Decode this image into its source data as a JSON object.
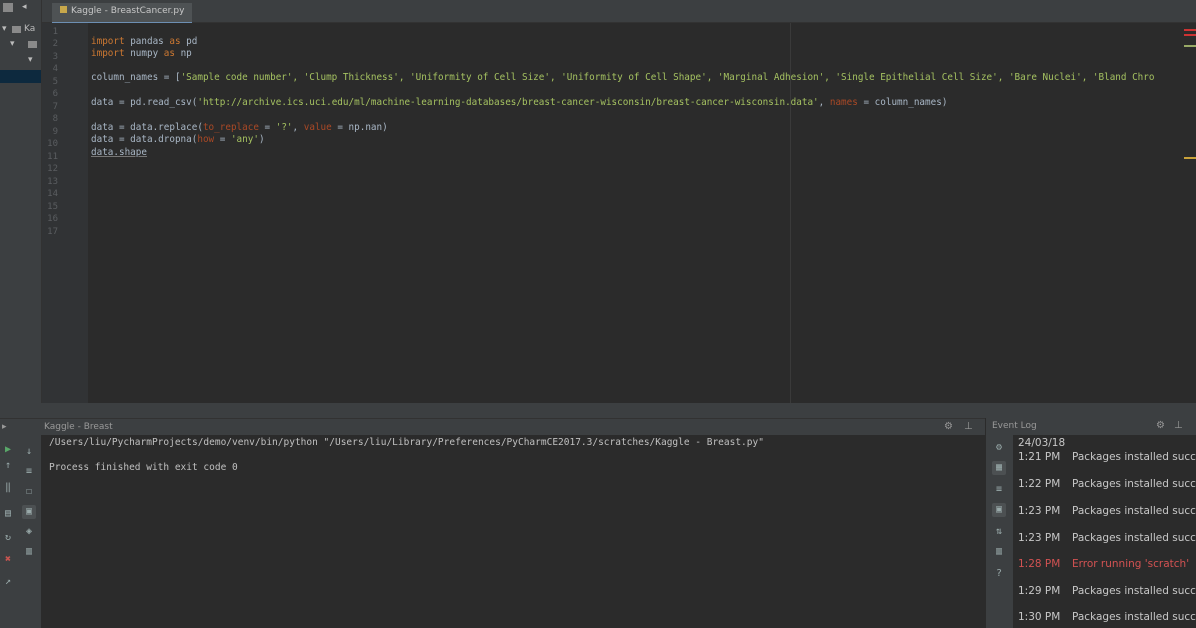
{
  "project_panel": {
    "items": [
      "Ka",
      "",
      "",
      ""
    ]
  },
  "editor": {
    "tab_label": "Kaggle - BreastCancer.py",
    "line_numbers": [
      "1",
      "2",
      "3",
      "4",
      "5",
      "6",
      "7",
      "8",
      "9",
      "10",
      "11",
      "12",
      "13",
      "14",
      "15",
      "16",
      "17"
    ],
    "lines": {
      "l1_kw": "import",
      "l1_rest": " pandas ",
      "l1_as": "as",
      "l1_alias": " pd",
      "l2_kw": "import",
      "l2_rest": " numpy ",
      "l2_as": "as",
      "l2_alias": " np",
      "l4_a": "column_names = [",
      "l4_str": "'Sample code number', 'Clump Thickness', 'Uniformity of Cell Size', 'Uniformity of Cell Shape', 'Marginal Adhesion', 'Single Epithelial Cell Size', 'Bare Nuclei', 'Bland Chro",
      "l6_a": "data = pd.read_csv(",
      "l6_str": "'http://archive.ics.uci.edu/ml/machine-learning-databases/breast-cancer-wisconsin/breast-cancer-wisconsin.data'",
      "l6_b": ", ",
      "l6_par": "names",
      "l6_c": " = column_names)",
      "l8_a": "data = data.replace(",
      "l8_par": "to_replace",
      "l8_b": " = ",
      "l8_str": "'?'",
      "l8_c": ", ",
      "l8_par2": "value",
      "l8_d": " = np.nan)",
      "l9_a": "data = data.dropna(",
      "l9_par": "how",
      "l9_b": " = ",
      "l9_str": "'any'",
      "l9_c": ")",
      "l10": "data.shape"
    }
  },
  "run": {
    "header_label": "Kaggle - Breast",
    "command": "/Users/liu/PycharmProjects/demo/venv/bin/python \"/Users/liu/Library/Preferences/PyCharmCE2017.3/scratches/Kaggle - Breast.py\"",
    "exit_message": "Process finished with exit code 0"
  },
  "event_log": {
    "title": "Event Log",
    "date": "24/03/18",
    "entries": [
      {
        "time": "1:21 PM",
        "text": "Packages installed succ",
        "error": false
      },
      {
        "time": "1:22 PM",
        "text": "Packages installed succ",
        "error": false
      },
      {
        "time": "1:23 PM",
        "text": "Packages installed succ",
        "error": false
      },
      {
        "time": "1:23 PM",
        "text": "Packages installed succ",
        "error": false
      },
      {
        "time": "1:28 PM",
        "text": "Error running 'scratch'",
        "error": true
      },
      {
        "time": "1:29 PM",
        "text": "Packages installed succ",
        "error": false
      },
      {
        "time": "1:30 PM",
        "text": "Packages installed succ",
        "error": false
      }
    ]
  },
  "colors": {
    "keyword": "#cc7832",
    "string": "#a5c261",
    "param": "#aa4926",
    "error": "#d25252",
    "selection": "#0d293e"
  },
  "icons": [
    "gear-icon",
    "hide-icon",
    "run-icon",
    "stop-icon",
    "rerun-icon",
    "trash-icon",
    "help-icon",
    "settings-icon"
  ]
}
